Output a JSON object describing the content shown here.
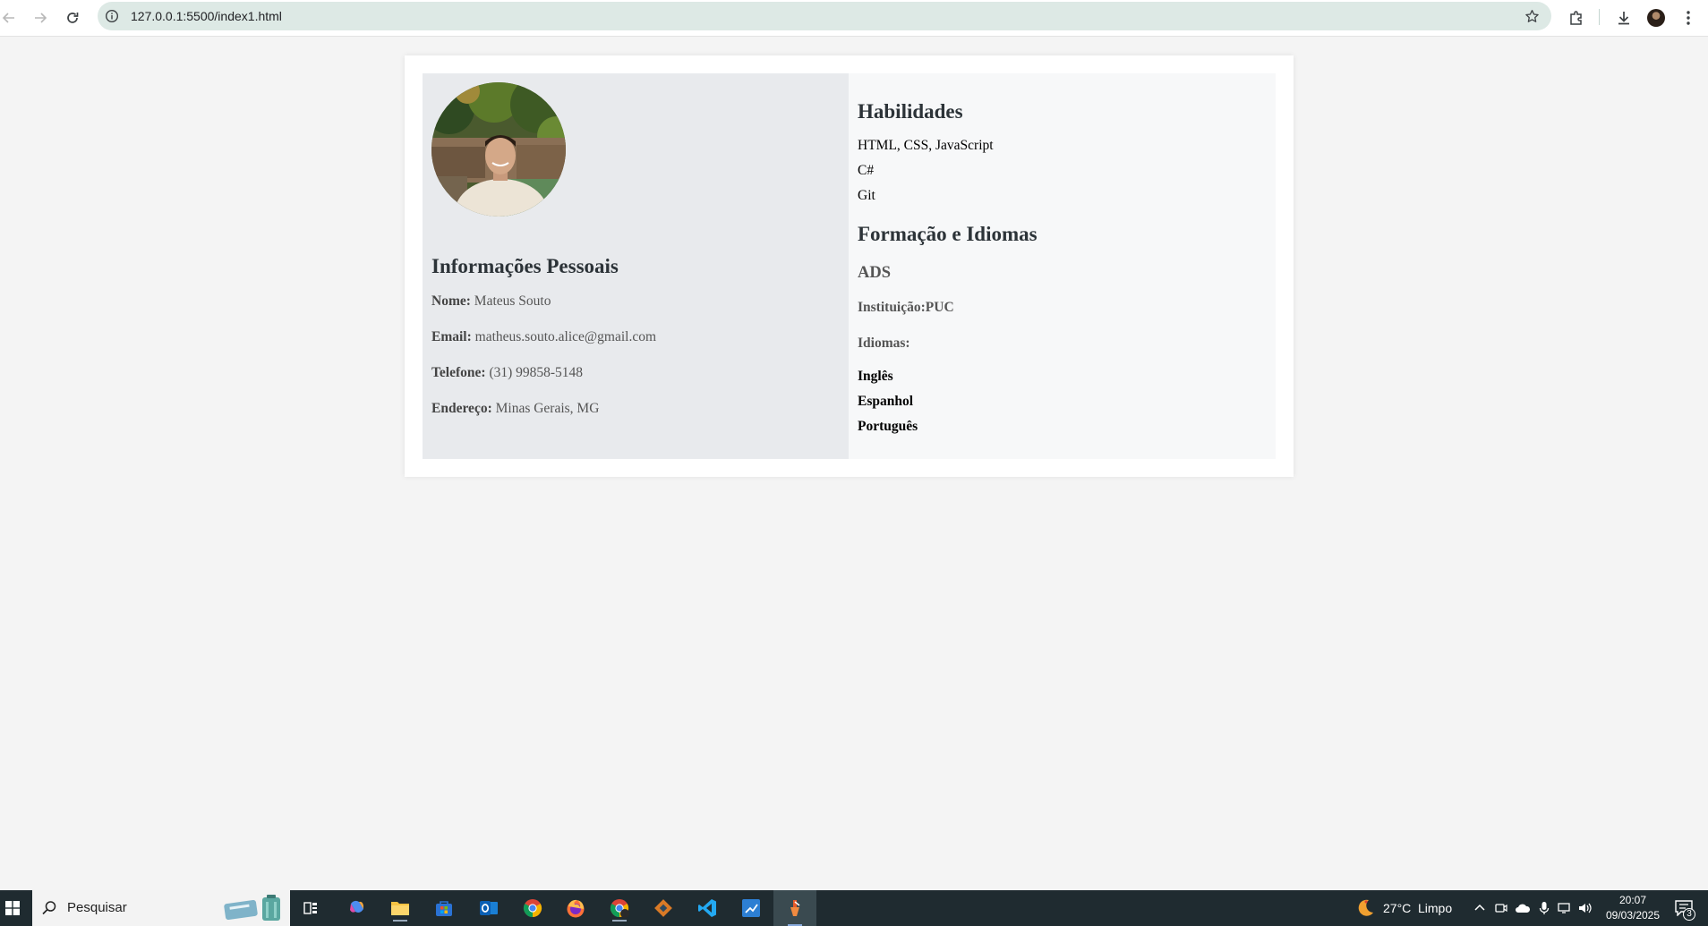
{
  "browser": {
    "url": "127.0.0.1:5500/index1.html"
  },
  "left": {
    "title": "Informações Pessoais",
    "fields": [
      {
        "label": "Nome:",
        "value": "Mateus Souto"
      },
      {
        "label": "Email:",
        "value": "matheus.souto.alice@gmail.com"
      },
      {
        "label": "Telefone:",
        "value": "(31) 99858-5148"
      },
      {
        "label": "Endereço:",
        "value": "Minas Gerais, MG"
      }
    ]
  },
  "right": {
    "skills_title": "Habilidades",
    "skills": [
      "HTML, CSS, JavaScript",
      "C#",
      "Git"
    ],
    "education_title": "Formação e Idiomas",
    "course": "ADS",
    "institution": "Instituição:PUC",
    "languages_label": "Idiomas:",
    "languages": [
      "Inglês",
      "Espanhol",
      "Português"
    ]
  },
  "taskbar": {
    "search_placeholder": "Pesquisar",
    "weather_temp": "27°C",
    "weather_text": "Limpo",
    "time": "20:07",
    "date": "09/03/2025",
    "notification_count": "3"
  }
}
